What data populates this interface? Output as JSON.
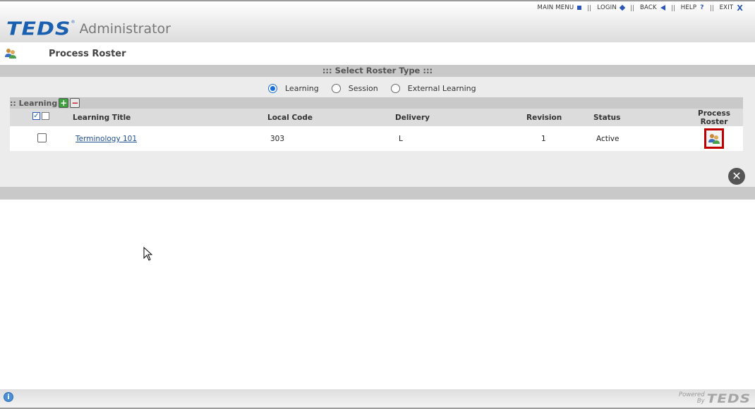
{
  "header": {
    "menu": [
      {
        "label": "MAIN MENU",
        "icon": "main-menu-square-icon"
      },
      {
        "label": "LOGIN",
        "icon": "login-diamond-icon"
      },
      {
        "label": "BACK",
        "icon": "back-arrow-icon"
      },
      {
        "label": "HELP",
        "icon": "help-question-icon",
        "glyph": "?"
      },
      {
        "label": "EXIT",
        "icon": "exit-x-icon",
        "glyph": "X"
      }
    ],
    "logo_text": "TEDS",
    "logo_reg": "®",
    "app_name": "Administrator"
  },
  "page": {
    "title": "Process Roster",
    "title_icon": "users-roster-icon"
  },
  "roster_type": {
    "heading": "::: Select Roster Type :::",
    "options": [
      {
        "label": "Learning",
        "selected": true
      },
      {
        "label": "Session",
        "selected": false
      },
      {
        "label": "External Learning",
        "selected": false
      }
    ]
  },
  "learning_section": {
    "heading": ":: Learning",
    "add_glyph": "+",
    "remove_glyph": "−",
    "check_glyph": "✓",
    "columns": {
      "title": "Learning Title",
      "local_code": "Local Code",
      "delivery": "Delivery",
      "revision": "Revision",
      "status": "Status",
      "process_line1": "Process",
      "process_line2": "Roster"
    },
    "rows": [
      {
        "title": "Terminology 101",
        "local_code": "303",
        "delivery": "L",
        "revision": "1",
        "status": "Active"
      }
    ]
  },
  "close_glyph": "✕",
  "footer": {
    "info_glyph": "i",
    "powered_line1": "Powered",
    "powered_line2": "By",
    "powered_logo": "TEDS"
  },
  "colors": {
    "brand_blue": "#1a5fb0",
    "accent_red": "#c00000",
    "bar_gray": "#c9c9c9"
  }
}
